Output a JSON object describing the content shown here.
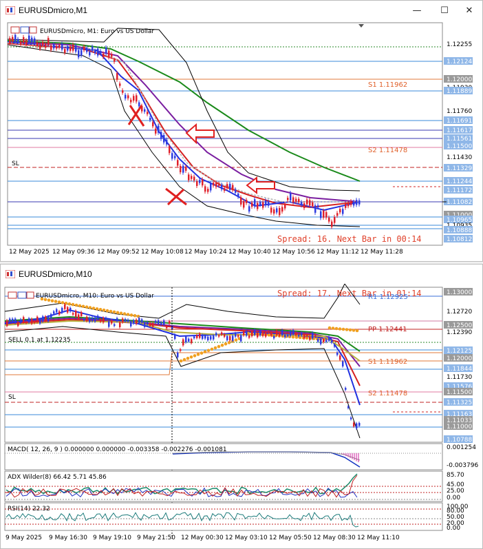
{
  "win1": {
    "title": "EURUSDmicro,M1",
    "subtitle": "EURUSDmicro, M1:  Euro vs US Dollar",
    "price_ticks": [
      "1.12255",
      "1.12124",
      "1.12000",
      "1.11930",
      "1.11889",
      "1.11760",
      "1.11691",
      "1.11617",
      "1.11561",
      "1.11500",
      "1.11430",
      "1.11329",
      "1.11244",
      "1.11172",
      "1.11082",
      "1.11000",
      "1.10965",
      "1.10935",
      "1.10888",
      "1.10812"
    ],
    "s1_label": "S1 1.11962",
    "s2_label": "S2 1.11478",
    "sl_label": "SL",
    "spread": "Spread: 16. Next Bar in 00:14",
    "time_ticks": [
      "12 May 2025",
      "12 May 09:36",
      "12 May 09:52",
      "12 May 10:08",
      "12 May 10:24",
      "12 May 10:40",
      "12 May 10:56",
      "12 May 11:12",
      "12 May 11:28"
    ]
  },
  "win2": {
    "title": "EURUSDmicro,M10",
    "subtitle": "EURUSDmicro, M10:  Euro vs US Dollar",
    "spread": "Spread: 17. Next Bar in 01:14",
    "r1_label": "R1 1.12925",
    "pp_label": "PP 1.12441",
    "s1_label": "S1 1.11962",
    "s2_label": "S2 1.11478",
    "sell_label": "SELL 0.1 at 1.12235",
    "sl_label": "SL",
    "price_ticks": [
      "1.13000",
      "1.12720",
      "1.12500",
      "1.12390",
      "1.12125",
      "1.12000",
      "1.11844",
      "1.11730",
      "1.11576",
      "1.11500",
      "1.11325",
      "1.11163",
      "1.11033",
      "1.11000",
      "1.10788"
    ],
    "macd_label": "MACD( 12, 26, 9 ) 0.000000 0.000000 -0.003358 -0.002276 -0.001081",
    "macd_ticks": [
      "0.001254",
      "-0.003796"
    ],
    "adx_label": "ADX Wilder(8) 66.42 5.71 45.86",
    "adx_ticks": [
      "85.70",
      "45.00",
      "25.00",
      "0.00"
    ],
    "rsi_label": "RSI(14) 22.32",
    "rsi_ticks": [
      "100.00",
      "80.00",
      "50.00",
      "20.00",
      "0.00"
    ],
    "time_ticks": [
      "9 May 2025",
      "9 May 16:30",
      "9 May 19:10",
      "9 May 21:50",
      "12 May 00:30",
      "12 May 03:10",
      "12 May 05:50",
      "12 May 08:30",
      "12 May 11:10"
    ]
  },
  "colors": {
    "bull": "#2d3be0",
    "bear": "#e0202a",
    "ma_green": "#1a8a1a",
    "ma_purple": "#7a1ea0",
    "ma_red": "#d62020",
    "ma_blue": "#2030e0",
    "spread_text": "#e0402a",
    "highlight_tag": "#8fb7e8"
  }
}
